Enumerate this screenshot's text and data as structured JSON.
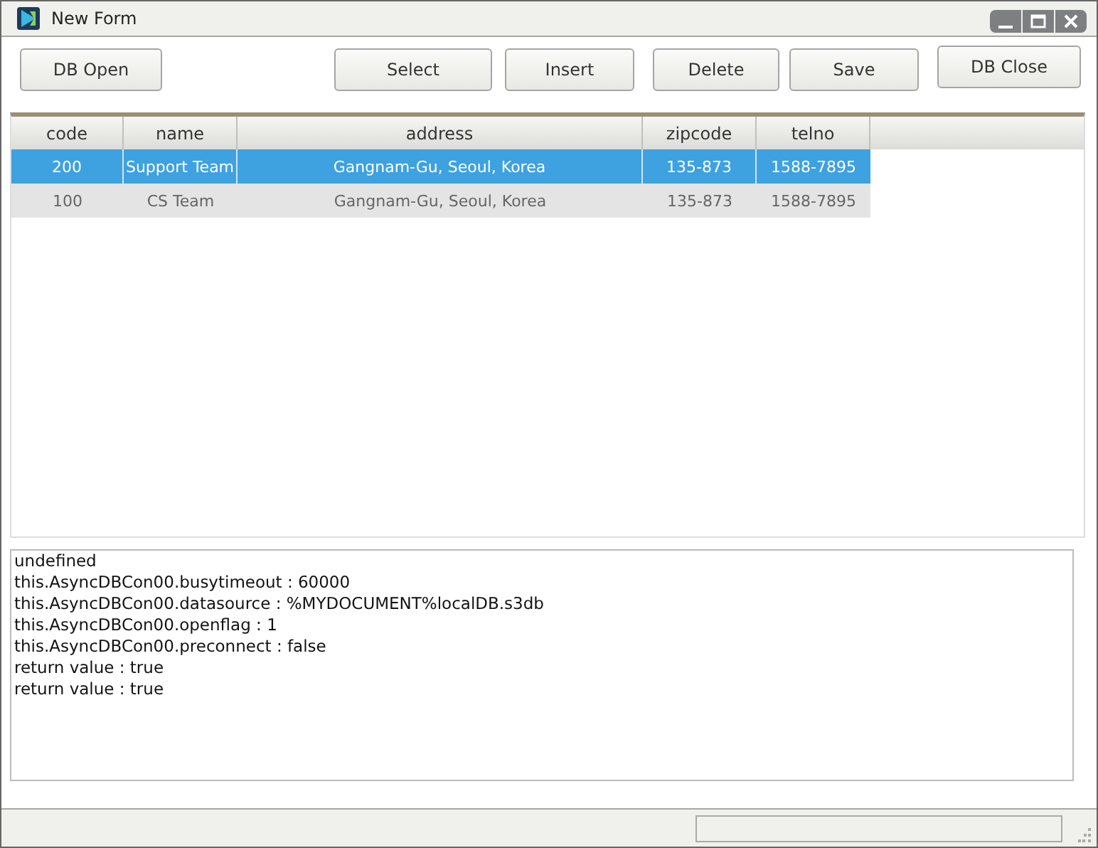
{
  "window": {
    "title": "New Form"
  },
  "buttons": [
    {
      "label": "DB Open"
    },
    {
      "label": "Select"
    },
    {
      "label": "Insert"
    },
    {
      "label": "Delete"
    },
    {
      "label": "Save"
    },
    {
      "label": "DB Close"
    }
  ],
  "table": {
    "columns": [
      "code",
      "name",
      "address",
      "zipcode",
      "telno"
    ],
    "rows": [
      {
        "cells": [
          "200",
          "Support Team",
          "Gangnam-Gu, Seoul, Korea",
          "135-873",
          "1588-7895"
        ],
        "selected": true
      },
      {
        "cells": [
          "100",
          "CS Team",
          "Gangnam-Gu, Seoul, Korea",
          "135-873",
          "1588-7895"
        ],
        "selected": false
      }
    ]
  },
  "log": [
    "undefined",
    "this.AsyncDBCon00.busytimeout : 60000",
    "this.AsyncDBCon00.datasource : %MYDOCUMENT%localDB.s3db",
    "this.AsyncDBCon00.openflag : 1",
    "this.AsyncDBCon00.preconnect : false",
    "return value : true",
    "return value : true"
  ]
}
